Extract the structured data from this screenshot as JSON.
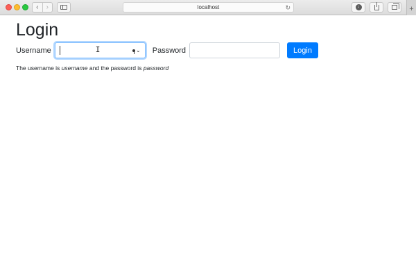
{
  "browser": {
    "url": "localhost",
    "back_glyph": "‹",
    "forward_glyph": "›",
    "reload_glyph": "↻",
    "download_glyph": "↓",
    "newtab_glyph": "+"
  },
  "page": {
    "title": "Login",
    "username_label": "Username",
    "username_value": "",
    "password_label": "Password",
    "password_value": "",
    "login_button": "Login",
    "hint": {
      "prefix": "The username is ",
      "username_word": "username",
      "middle": " and the password is ",
      "password_word": "password"
    },
    "keychain_chevron": "⌄"
  },
  "colors": {
    "accent": "#007bff",
    "focus_ring": "#80bdff"
  }
}
